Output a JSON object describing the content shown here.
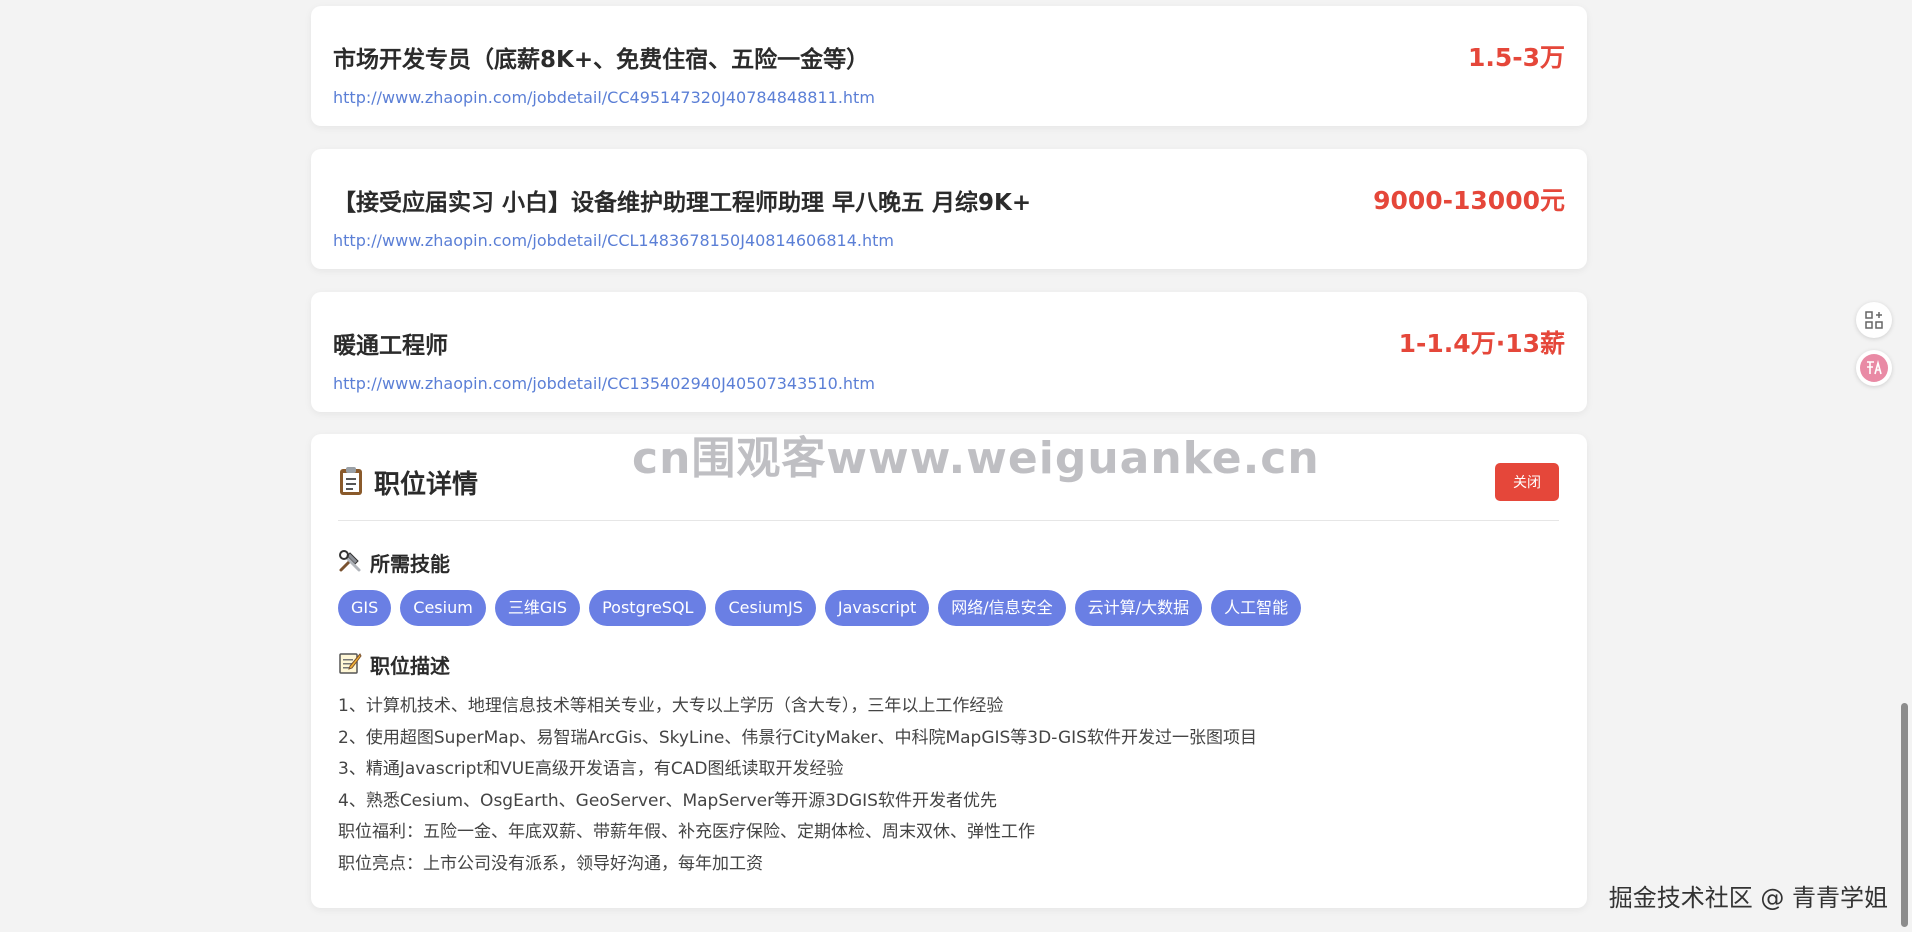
{
  "jobs": [
    {
      "title": "市场开发专员（底薪8K+、免费住宿、五险一金等）",
      "link": "http://www.zhaopin.com/jobdetail/CC495147320J40784848811.htm",
      "salary": "1.5-3万"
    },
    {
      "title": "【接受应届实习 小白】设备维护助理工程师助理 早八晚五 月综9K+",
      "link": "http://www.zhaopin.com/jobdetail/CCL1483678150J40814606814.htm",
      "salary": "9000-13000元"
    },
    {
      "title": "暖通工程师",
      "link": "http://www.zhaopin.com/jobdetail/CC135402940J40507343510.htm",
      "salary": "1-1.4万·13薪"
    }
  ],
  "detail": {
    "title": "职位详情",
    "close_label": "关闭",
    "skills_title": "所需技能",
    "skills": [
      "GIS",
      "Cesium",
      "三维GIS",
      "PostgreSQL",
      "CesiumJS",
      "Javascript",
      "网络/信息安全",
      "云计算/大数据",
      "人工智能"
    ],
    "desc_title": "职位描述",
    "desc_lines": [
      "1、计算机技术、地理信息技术等相关专业，大专以上学历（含大专），三年以上工作经验",
      "2、使用超图SuperMap、易智瑞ArcGis、SkyLine、伟景行CityMaker、中科院MapGIS等3D-GIS软件开发过一张图项目",
      "3、精通Javascript和VUE高级开发语言，有CAD图纸读取开发经验",
      "4、熟悉Cesium、OsgEarth、GeoServer、MapServer等开源3DGIS软件开发者优先",
      "职位福利：五险一金、年底双薪、带薪年假、补充医疗保险、定期体检、周末双休、弹性工作",
      "职位亮点：上市公司没有派系，领导好沟通，每年加工资"
    ]
  },
  "watermark": "cn围观客www.weiguanke.cn",
  "footer_credit": "掘金技术社区 @ 青青学姐",
  "side_icons": [
    "grid-plus-icon",
    "translate-icon"
  ],
  "colors": {
    "salary": "#e5473a",
    "link": "#5b7fd6",
    "tag": "#6a7fe4",
    "close_button": "#e5473a"
  }
}
